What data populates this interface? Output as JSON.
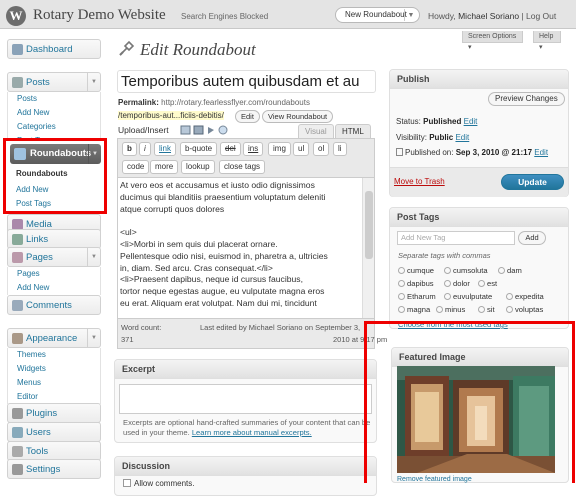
{
  "header": {
    "logo_letter": "W",
    "site_title": "Rotary Demo Website",
    "search_blocked": "Search Engines Blocked",
    "favorite_action": "New Roundabout",
    "howdy": "Howdy,",
    "user_name": "Michael Soriano",
    "logout": "Log Out",
    "screen_options": "Screen Options",
    "help": "Help"
  },
  "sidebar": {
    "dashboard": "Dashboard",
    "posts": "Posts",
    "posts_sub": [
      "Posts",
      "Add New",
      "Categories",
      "Post Tags"
    ],
    "roundabouts": "Roundabouts",
    "roundabouts_sub": [
      "Roundabouts",
      "Add New",
      "Post Tags"
    ],
    "media": "Media",
    "links": "Links",
    "pages": "Pages",
    "pages_sub": [
      "Pages",
      "Add New"
    ],
    "comments": "Comments",
    "appearance": "Appearance",
    "appearance_sub": [
      "Themes",
      "Widgets",
      "Menus",
      "Editor"
    ],
    "plugins": "Plugins",
    "users": "Users",
    "tools": "Tools",
    "settings": "Settings"
  },
  "editor": {
    "page_title": "Edit Roundabout",
    "post_title": "Temporibus autem quibusdam et au",
    "permalink_label": "Permalink:",
    "permalink_base": "http://rotary.fearlessflyer.com/roundabouts",
    "permalink_slug": "/temporibus-aut...ficiis-debitis/",
    "edit_btn": "Edit",
    "view_btn": "View Roundabout",
    "upload_insert": "Upload/Insert",
    "tab_visual": "Visual",
    "tab_html": "HTML",
    "toolbar_row1": [
      "b",
      "i",
      "link",
      "b-quote",
      "del",
      "ins",
      "img",
      "ul",
      "ol",
      "li"
    ],
    "toolbar_row2": [
      "code",
      "more",
      "lookup",
      "close tags"
    ],
    "content_lines": [
      "At vero eos et accusamus et iusto odio dignissimos",
      "ducimus qui blanditiis praesentium voluptatum deleniti",
      "atque corrupti quos dolores",
      "",
      "<ul>",
      "   <li>Morbi in sem quis dui placerat ornare.",
      "Pellentesque odio nisi, euismod in, pharetra a, ultricies",
      "in, diam. Sed arcu. Cras consequat.</li>",
      "   <li>Praesent dapibus, neque id cursus faucibus,",
      "tortor neque egestas augue, eu vulputate magna eros",
      "eu erat. Aliquam erat volutpat. Nam dui mi, tincidunt"
    ],
    "word_count_label": "Word count:",
    "word_count": "371",
    "last_edited": "Last edited by Michael Soriano on September 3,",
    "last_edited_time": "2010 at 9:17 pm"
  },
  "excerpt": {
    "title": "Excerpt",
    "note": "Excerpts are optional hand-crafted summaries of your content that can be used in your theme.",
    "link": "Learn more about manual excerpts."
  },
  "discussion": {
    "title": "Discussion",
    "allow_comments": "Allow comments."
  },
  "publish": {
    "title": "Publish",
    "preview": "Preview Changes",
    "status_label": "Status:",
    "status": "Published",
    "visibility_label": "Visibility:",
    "visibility": "Public",
    "published_on_label": "Published on:",
    "published_on": "Sep 3, 2010 @ 21:17",
    "edit": "Edit",
    "trash": "Move to Trash",
    "update": "Update"
  },
  "post_tags": {
    "title": "Post Tags",
    "placeholder": "Add New Tag",
    "add": "Add",
    "separate": "Separate tags with commas",
    "tags": [
      "cumque",
      "cumsoluta",
      "dam",
      "dapibus",
      "dolor",
      "est",
      "Etharum",
      "euvulputate",
      "expedita",
      "magna",
      "minus",
      "sit",
      "voluptas"
    ],
    "most_used": "Choose from the most used tags"
  },
  "featured_image": {
    "title": "Featured Image",
    "remove": "Remove featured image"
  },
  "colors": {
    "link": "#21759b",
    "highlight": "#e00000"
  }
}
